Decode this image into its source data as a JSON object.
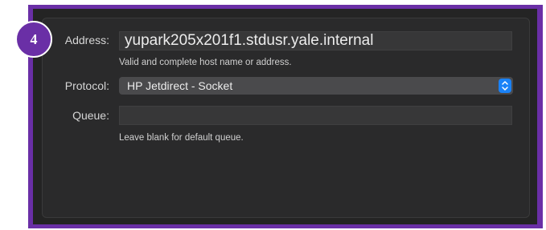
{
  "step_badge": "4",
  "address": {
    "label": "Address:",
    "value": "yupark205x201f1.stdusr.yale.internal",
    "hint": "Valid and complete host name or address."
  },
  "protocol": {
    "label": "Protocol:",
    "selected": "HP Jetdirect - Socket",
    "stepper_icon": "chevron-up-down-icon",
    "accent_color": "#1a82f7"
  },
  "queue": {
    "label": "Queue:",
    "value": "",
    "hint": "Leave blank for default queue."
  },
  "colors": {
    "frame": "#6a2fa6",
    "panel": "#2a2a2b"
  }
}
